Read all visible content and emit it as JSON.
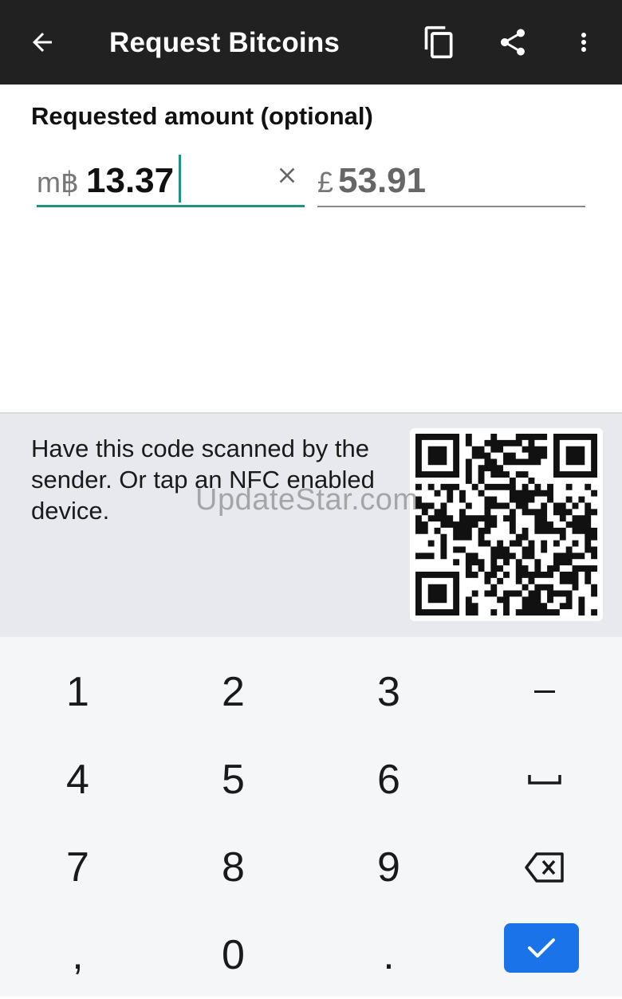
{
  "appbar": {
    "title": "Request Bitcoins",
    "icons": [
      "arrow-back-icon",
      "copy-icon",
      "share-icon",
      "more-vert-icon"
    ]
  },
  "amount": {
    "label": "Requested amount (optional)",
    "btc_prefix": "m฿",
    "btc_value": "13.37",
    "gbp_prefix": "£",
    "gbp_value": "53.91"
  },
  "scan": {
    "text": "Have this code scanned by the sender. Or tap an NFC enabled device."
  },
  "watermark": "UpdateStar.com",
  "keypad": {
    "rows": [
      [
        "1",
        "2",
        "3",
        "–"
      ],
      [
        "4",
        "5",
        "6",
        "␣"
      ],
      [
        "7",
        "8",
        "9",
        "⌫"
      ],
      [
        ",",
        "0",
        ".",
        "✓"
      ]
    ]
  },
  "colors": {
    "appbar_bg": "#212121",
    "accent": "#1e9382",
    "confirm_blue": "#1a73e8",
    "panel_bg": "#e8e9ef",
    "keypad_bg": "#f5f6f8"
  }
}
